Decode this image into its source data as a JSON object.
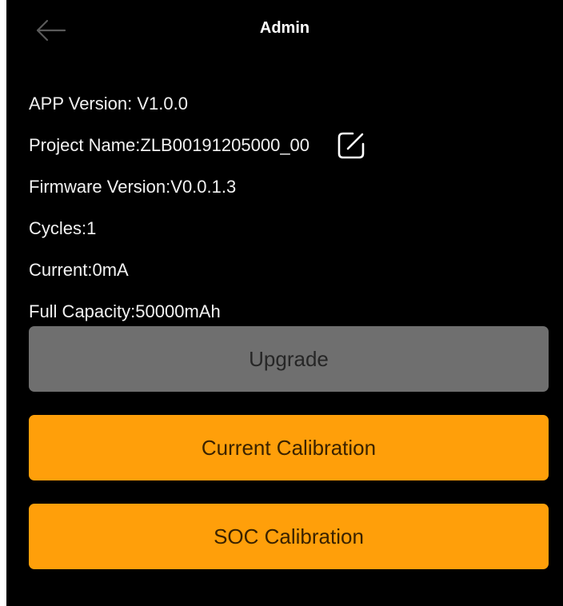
{
  "header": {
    "back_icon": "arrow-left-icon",
    "title": "Admin"
  },
  "info": {
    "app_version": "APP Version: V1.0.0",
    "project_name": "Project Name:ZLB00191205000_00",
    "edit_icon": "edit-square-icon",
    "firmware_version": "Firmware Version:V0.0.1.3",
    "cycles": "Cycles:1",
    "current": "Current:0mA",
    "full_capacity": "Full Capacity:50000mAh"
  },
  "buttons": {
    "upgrade": "Upgrade",
    "current_calibration": "Current Calibration",
    "soc_calibration": "SOC Calibration"
  },
  "colors": {
    "background": "#000000",
    "accent": "#ff9f0a",
    "disabled": "#6f6f6f",
    "back_icon": "#5a5a5a"
  }
}
